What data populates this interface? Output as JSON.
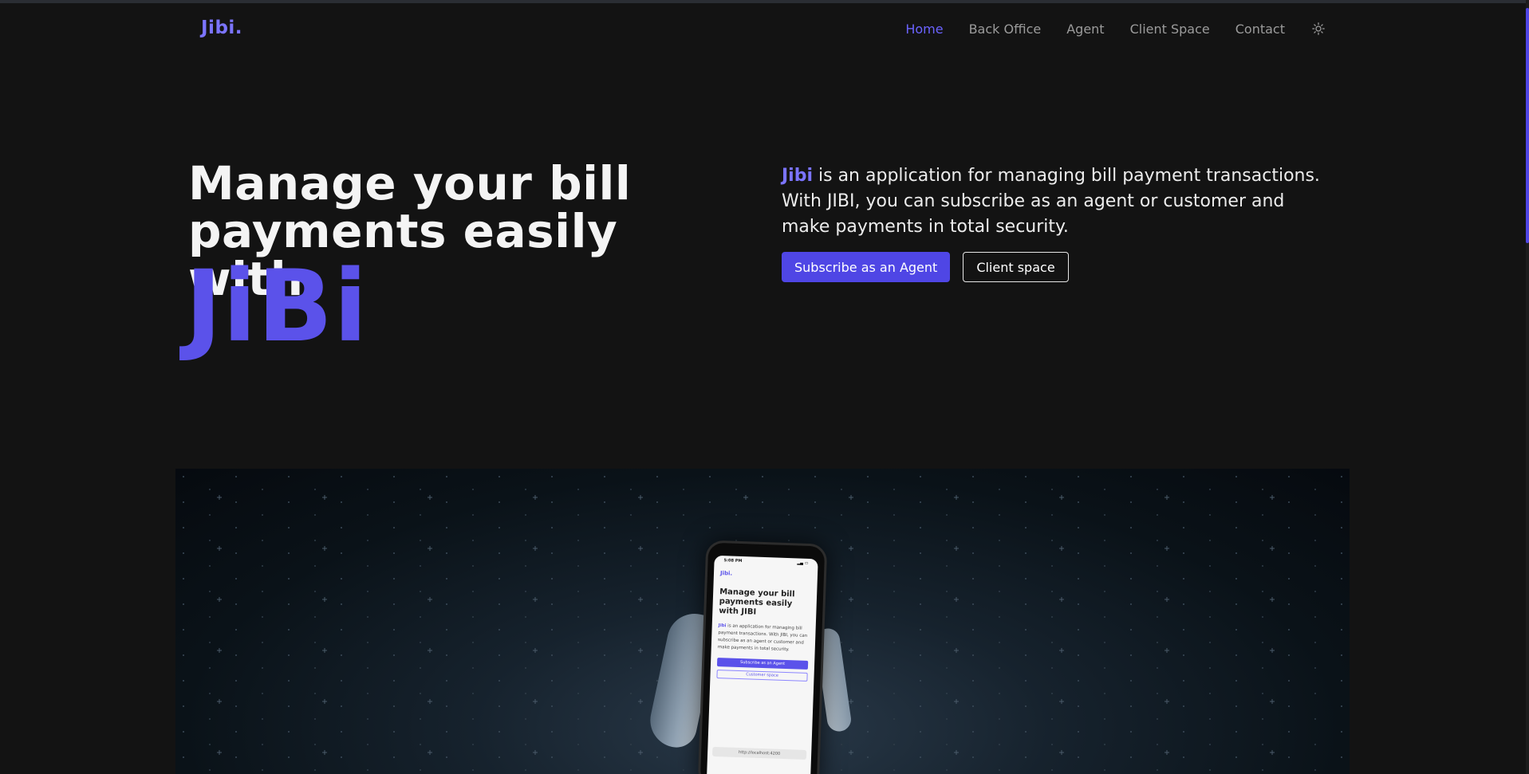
{
  "header": {
    "logo": "Jibi.",
    "nav": [
      {
        "label": "Home",
        "active": true
      },
      {
        "label": "Back Office",
        "active": false
      },
      {
        "label": "Agent",
        "active": false
      },
      {
        "label": "Client Space",
        "active": false
      },
      {
        "label": "Contact",
        "active": false
      }
    ],
    "theme_toggle_icon": "sun-icon"
  },
  "hero": {
    "title": "Manage your bill payments easily with",
    "brand": "JiBi",
    "desc_brand": "Jibi",
    "desc_rest": " is an application for managing bill payment transactions. With JIBI, you can subscribe as an agent or customer and make payments in total security.",
    "primary_cta": "Subscribe as an Agent",
    "secondary_cta": "Client space"
  },
  "showcase": {
    "phone": {
      "status_time": "5:08 PM",
      "logo": "Jibi.",
      "title": "Manage your bill payments easily with JIBI",
      "desc_brand": "Jibi",
      "desc_rest": " is an application for managing bill payment transactions. With JIBI, you can subscribe as an agent or customer and make payments in total security.",
      "primary_cta": "Subscribe as an Agent",
      "secondary_cta": "Customer space",
      "url": "http://localhost:4200"
    }
  },
  "colors": {
    "accent": "#4f46e5",
    "brand_text": "#7b74ff",
    "background": "#131313"
  }
}
